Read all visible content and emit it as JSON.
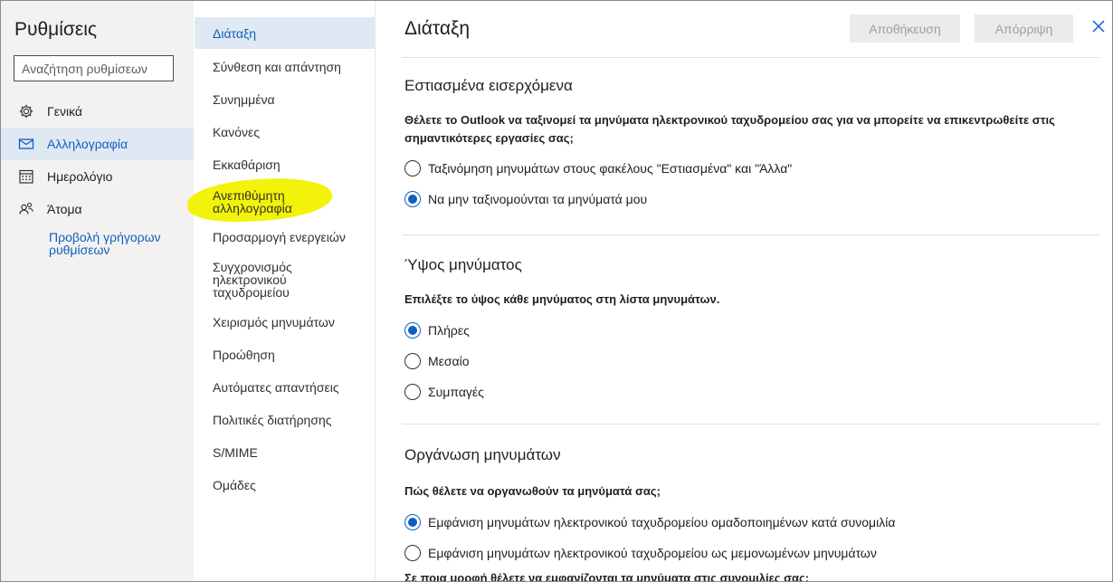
{
  "settings": {
    "title": "Ρυθμίσεις",
    "search_placeholder": "Αναζήτηση ρυθμίσεων",
    "nav": [
      {
        "label": "Γενικά",
        "icon": "gear-icon"
      },
      {
        "label": "Αλληλογραφία",
        "icon": "mail-icon"
      },
      {
        "label": "Ημερολόγιο",
        "icon": "calendar-icon"
      },
      {
        "label": "Άτομα",
        "icon": "people-icon"
      }
    ],
    "active_nav": "Αλληλογραφία",
    "quick_settings_link": "Προβολή γρήγορων ρυθμίσεων"
  },
  "mail_menu": {
    "items": [
      "Διάταξη",
      "Σύνθεση και απάντηση",
      "Συνημμένα",
      "Κανόνες",
      "Εκκαθάριση",
      "Ανεπιθύμητη αλληλογραφία",
      "Προσαρμογή ενεργειών",
      "Συγχρονισμός ηλεκτρονικού ταχυδρομείου",
      "Χειρισμός μηνυμάτων",
      "Προώθηση",
      "Αυτόματες απαντήσεις",
      "Πολιτικές διατήρησης",
      "S/MIME",
      "Ομάδες"
    ],
    "active": "Διάταξη",
    "highlighted": "Ανεπιθύμητη αλληλογραφία",
    "highlight_color": "#f2f20a"
  },
  "layout_page": {
    "title": "Διάταξη",
    "save_label": "Αποθήκευση",
    "discard_label": "Απόρριψη",
    "focused_inbox": {
      "title": "Εστιασμένα εισερχόμενα",
      "question": "Θέλετε το Outlook να ταξινομεί τα μηνύματα ηλεκτρονικού ταχυδρομείου σας για να μπορείτε να επικεντρωθείτε στις σημαντικότερες εργασίες σας;",
      "options": [
        "Ταξινόμηση μηνυμάτων στους φακέλους \"Εστιασμένα\" και \"Άλλα\"",
        "Να μην ταξινομούνται τα μηνύματά μου"
      ],
      "selected": 1
    },
    "message_height": {
      "title": "Ύψος μηνύματος",
      "question": "Επιλέξτε το ύψος κάθε μηνύματος στη λίστα μηνυμάτων.",
      "options": [
        "Πλήρες",
        "Μεσαίο",
        "Συμπαγές"
      ],
      "selected": 0
    },
    "message_organization": {
      "title": "Οργάνωση μηνυμάτων",
      "question": "Πώς θέλετε να οργανωθούν τα μηνύματά σας;",
      "options": [
        "Εμφάνιση μηνυμάτων ηλεκτρονικού ταχυδρομείου ομαδοποιημένων κατά συνομιλία",
        "Εμφάνιση μηνυμάτων ηλεκτρονικού ταχυδρομείου ως μεμονωμένων μηνυμάτων"
      ],
      "selected": 0,
      "cut_off_text": "Σε ποια μορφή θέλετε να εμφανίζονται τα μηνύματα στις συνομιλίες σας;"
    },
    "accent_color": "#0f5fbf"
  }
}
